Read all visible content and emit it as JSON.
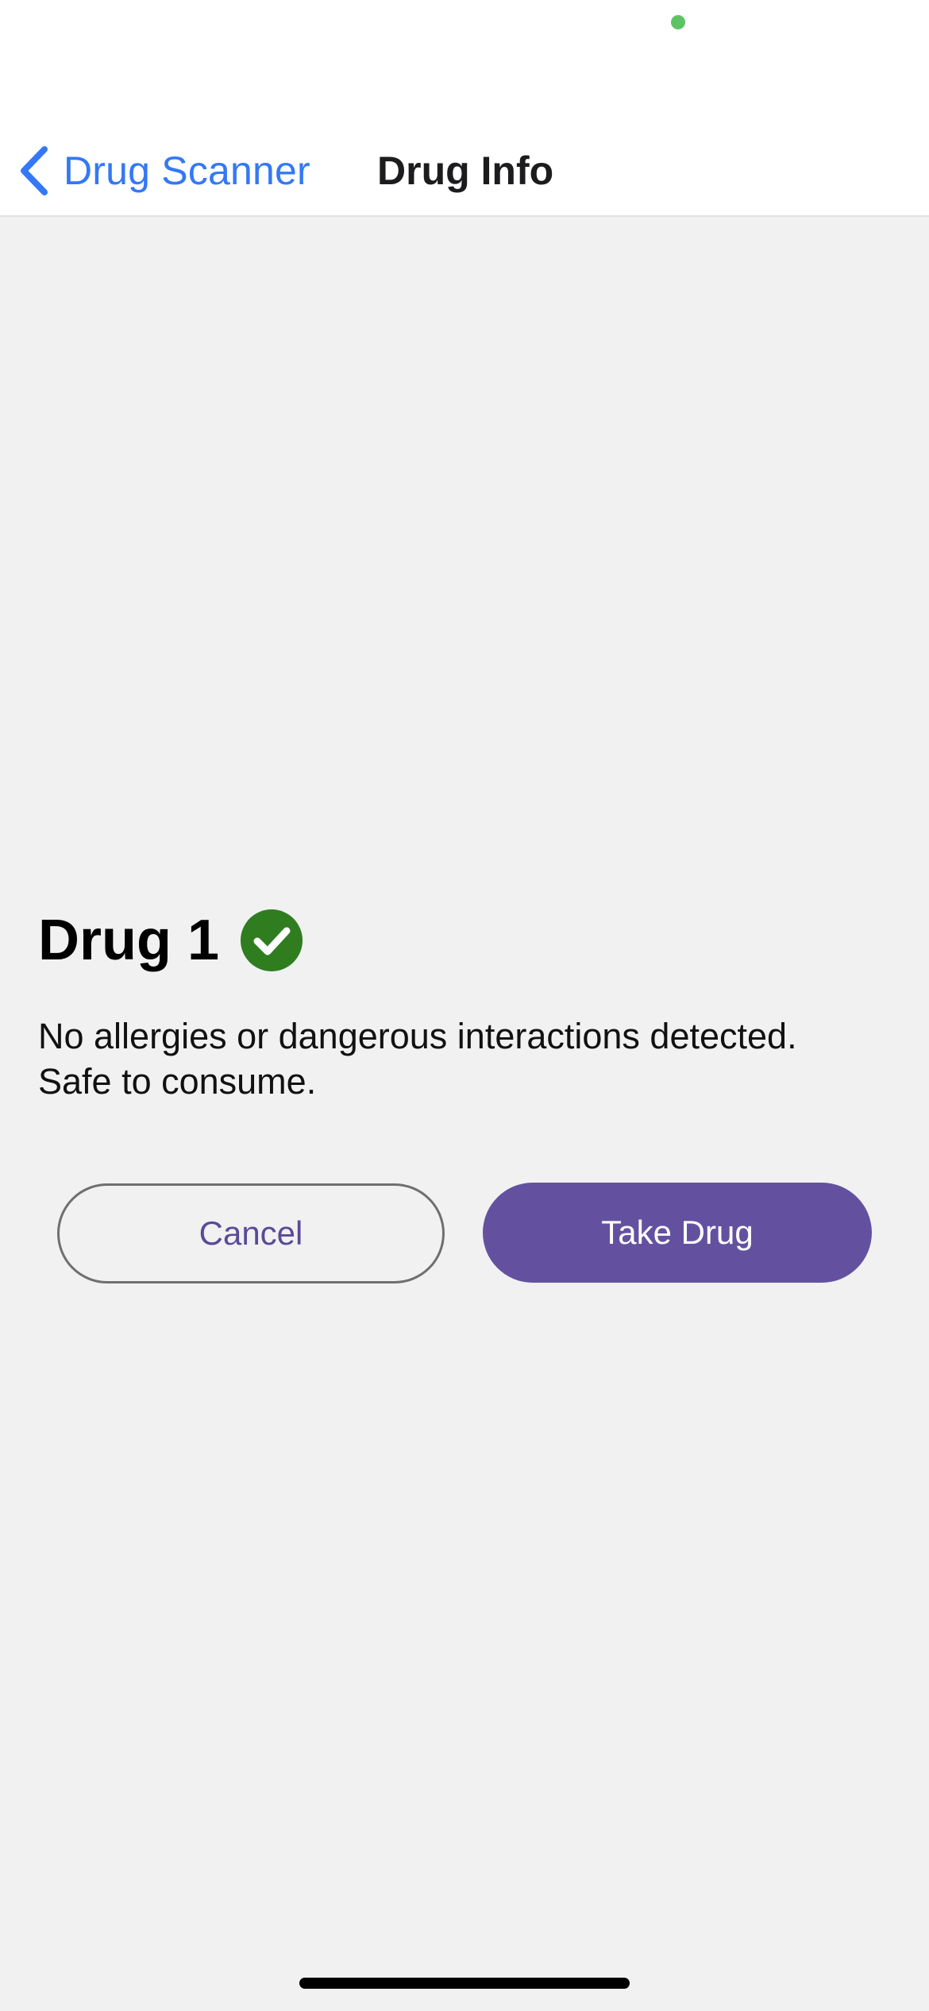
{
  "nav": {
    "back_label": "Drug Scanner",
    "title": "Drug Info"
  },
  "drug": {
    "name": "Drug 1",
    "status_icon": "check-circle-icon",
    "message_line1": "No allergies or dangerous interactions detected.",
    "message_line2": "Safe to consume."
  },
  "actions": {
    "cancel_label": "Cancel",
    "take_label": "Take Drug"
  },
  "colors": {
    "accent_blue": "#3478f6",
    "primary_purple": "#6351a0",
    "cancel_text": "#5a4a98",
    "success_green": "#2f7d1f",
    "privacy_dot": "#5dc465",
    "background": "#f1f1f2"
  }
}
